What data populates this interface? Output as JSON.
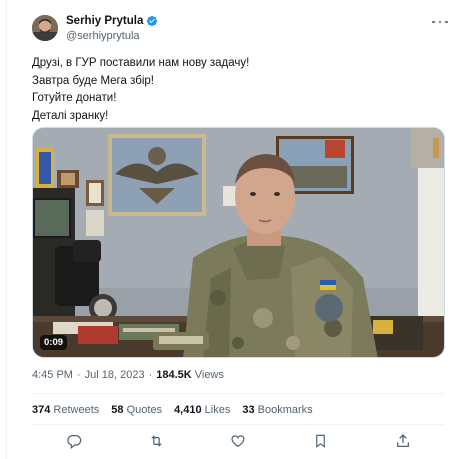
{
  "author": {
    "display_name": "Serhiy Prytula",
    "handle": "@serhiyprytula",
    "verified": true,
    "avatar_icon": "avatar-photo"
  },
  "tweet": {
    "lines": [
      "Друзі, в ГУР поставили нам нову задачу!",
      "Завтра буде Мега збір!",
      "Готуйте донати!",
      "Деталі зранку!"
    ]
  },
  "media": {
    "type": "video",
    "duration": "0:09"
  },
  "meta": {
    "time": "4:45 PM",
    "separator": "·",
    "date": "Jul 18, 2023",
    "views_count": "184.5K",
    "views_label": "Views"
  },
  "stats": {
    "retweets_count": "374",
    "retweets_label": "Retweets",
    "quotes_count": "58",
    "quotes_label": "Quotes",
    "likes_count": "4,410",
    "likes_label": "Likes",
    "bookmarks_count": "33",
    "bookmarks_label": "Bookmarks"
  },
  "actions": [
    "reply-icon",
    "retweet-icon",
    "like-icon",
    "bookmark-icon",
    "share-icon"
  ],
  "colors": {
    "text_primary": "#0f1419",
    "text_secondary": "#536471",
    "verified_blue": "#1d9bf0",
    "divider": "#eff3f4"
  }
}
